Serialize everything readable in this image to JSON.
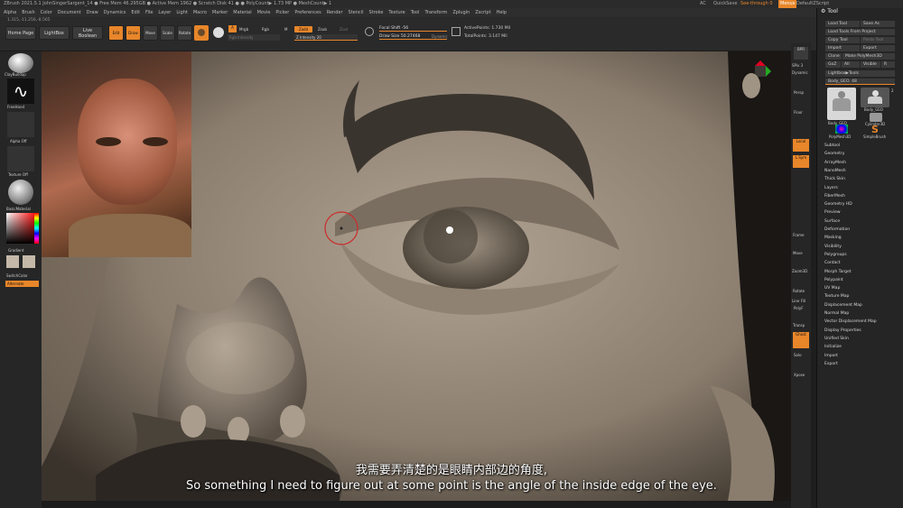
{
  "titlebar": {
    "text": "ZBrush 2021.5.1    JohnSingerSargent_14    ● Free Mem 46.295GB ● Active Mem 1962 ● Scratch Disk 41 ● ● PolyCount▶ 1.73 MP ● MeshCount▶ 1",
    "ac": "AC",
    "quicksave": "QuickSave",
    "seethrough": "See-through 0",
    "menus": "Menus",
    "script": "DefaultZScript"
  },
  "menu": [
    "Alpha",
    "Brush",
    "Color",
    "Document",
    "Draw",
    "Dynamics",
    "Edit",
    "File",
    "Layer",
    "Light",
    "Macro",
    "Marker",
    "Material",
    "Movie",
    "Picker",
    "Preferences",
    "Render",
    "Stencil",
    "Stroke",
    "Texture",
    "Tool",
    "Transform",
    "Zplugin",
    "Zscript",
    "Help"
  ],
  "coords": "1.315,-11.256,-8.565",
  "topbar": {
    "home": "Home Page",
    "lightbox": "LightBox",
    "boolean": "Live Boolean",
    "tools": [
      "Edit",
      "Draw",
      "Move",
      "Scale",
      "Rotate"
    ],
    "mrgb": "Mrgb",
    "rgb": "Rgb",
    "m": "M",
    "zadd": "Zadd",
    "zsub": "Zsub",
    "zcut": "Zcut",
    "rgb_intensity": "Rgb Intensity",
    "z_intensity": "Z Intensity 20",
    "focal": "Focal Shift -56",
    "drawsize": "Draw Size 50.27468",
    "dynamic": "Dynamic",
    "active": "ActivePoints: 1.730 Mil",
    "total": "TotalPoints: 3.147 Mil"
  },
  "left": {
    "brush": "ClayBuildup",
    "stroke": "FreeHand",
    "alpha": "Alpha Off",
    "texture": "Texture Off",
    "material": "BasicMaterial",
    "gradient": "Gradient",
    "switch": "SwitchColor",
    "alternate": "Alternate"
  },
  "right_strip": [
    "BPR",
    "SPix 3",
    "Dynamic",
    "Persp",
    "Floor",
    "Local",
    "L.Sym",
    "Frame",
    "Move",
    "Zoom3D",
    "Rotate",
    "Line Fill",
    "PolyF",
    "Transp",
    "Ghost",
    "Solo",
    "Xpose"
  ],
  "tool": {
    "title": "Tool",
    "buttons": [
      "Load Tool",
      "Save As",
      "Load Tools From Project",
      "Copy Tool",
      "Paste Tool",
      "Import",
      "Export",
      "Clone",
      "Make PolyMesh3D",
      "GoZ",
      "All",
      "Visible",
      "R"
    ],
    "lightbox_tools": "Lightbox▶Tools",
    "slider": "Body_GEO. 48",
    "thumbs": [
      "Body_GEO",
      "Body_GEO",
      "Cylinder3D",
      "PolyMesh3D",
      "SimpleBrush"
    ],
    "thumb_count": "2",
    "subpalettes": [
      "Subtool",
      "Geometry",
      "ArrayMesh",
      "NanoMesh",
      "Thick Skin",
      "Layers",
      "FiberMesh",
      "Geometry HD",
      "Preview",
      "Surface",
      "Deformation",
      "Masking",
      "Visibility",
      "Polygroups",
      "Contact",
      "Morph Target",
      "Polypaint",
      "UV Map",
      "Texture Map",
      "Displacement Map",
      "Normal Map",
      "Vector Displacement Map",
      "Display Properties",
      "Unified Skin",
      "Initialize",
      "Import",
      "Export"
    ]
  },
  "subtitle": {
    "zh": "我需要弄清楚的是眼睛内部边的角度,",
    "en": "So something I need to figure out at some point is the angle of the inside edge of the eye."
  },
  "colors": {
    "accent": "#e8862a",
    "ui": "#2a2a2a",
    "clay": "#8a7d6e"
  }
}
